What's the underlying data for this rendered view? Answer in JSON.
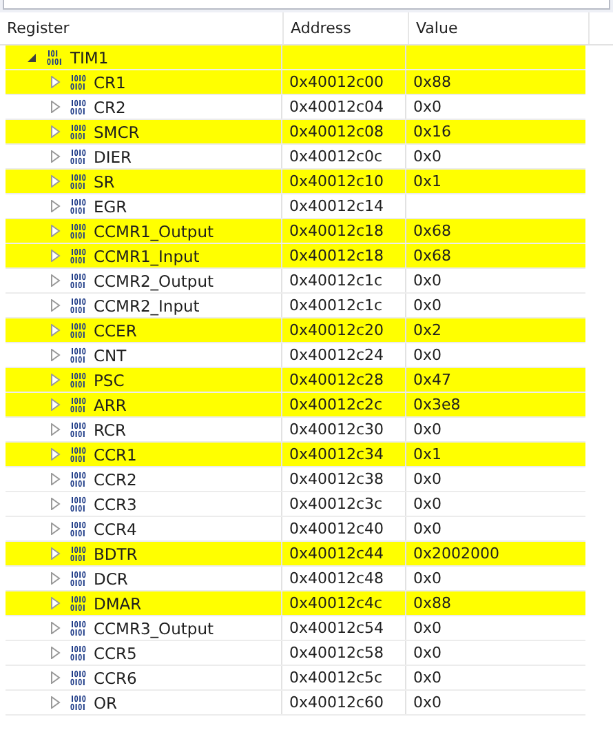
{
  "columns": [
    "Register",
    "Address",
    "Value"
  ],
  "tree": [
    {
      "name": "TIM1",
      "kind": "peripheral",
      "expanded": true,
      "highlighted": true,
      "children": [
        {
          "name": "CR1",
          "kind": "register",
          "expanded": false,
          "highlighted": true,
          "address": "0x40012c00",
          "value": "0x88"
        },
        {
          "name": "CR2",
          "kind": "register",
          "expanded": false,
          "highlighted": false,
          "address": "0x40012c04",
          "value": "0x0"
        },
        {
          "name": "SMCR",
          "kind": "register",
          "expanded": false,
          "highlighted": true,
          "address": "0x40012c08",
          "value": "0x16"
        },
        {
          "name": "DIER",
          "kind": "register",
          "expanded": false,
          "highlighted": false,
          "address": "0x40012c0c",
          "value": "0x0"
        },
        {
          "name": "SR",
          "kind": "register",
          "expanded": false,
          "highlighted": true,
          "address": "0x40012c10",
          "value": "0x1"
        },
        {
          "name": "EGR",
          "kind": "register",
          "expanded": false,
          "highlighted": false,
          "address": "0x40012c14"
        },
        {
          "name": "CCMR1_Output",
          "kind": "register",
          "expanded": false,
          "highlighted": true,
          "address": "0x40012c18",
          "value": "0x68"
        },
        {
          "name": "CCMR1_Input",
          "kind": "register",
          "expanded": false,
          "highlighted": true,
          "address": "0x40012c18",
          "value": "0x68"
        },
        {
          "name": "CCMR2_Output",
          "kind": "register",
          "expanded": false,
          "highlighted": false,
          "address": "0x40012c1c",
          "value": "0x0"
        },
        {
          "name": "CCMR2_Input",
          "kind": "register",
          "expanded": false,
          "highlighted": false,
          "address": "0x40012c1c",
          "value": "0x0"
        },
        {
          "name": "CCER",
          "kind": "register",
          "expanded": false,
          "highlighted": true,
          "address": "0x40012c20",
          "value": "0x2"
        },
        {
          "name": "CNT",
          "kind": "register",
          "expanded": false,
          "highlighted": false,
          "address": "0x40012c24",
          "value": "0x0"
        },
        {
          "name": "PSC",
          "kind": "register",
          "expanded": false,
          "highlighted": true,
          "address": "0x40012c28",
          "value": "0x47"
        },
        {
          "name": "ARR",
          "kind": "register",
          "expanded": false,
          "highlighted": true,
          "address": "0x40012c2c",
          "value": "0x3e8"
        },
        {
          "name": "RCR",
          "kind": "register",
          "expanded": false,
          "highlighted": false,
          "address": "0x40012c30",
          "value": "0x0"
        },
        {
          "name": "CCR1",
          "kind": "register",
          "expanded": false,
          "highlighted": true,
          "address": "0x40012c34",
          "value": "0x1"
        },
        {
          "name": "CCR2",
          "kind": "register",
          "expanded": false,
          "highlighted": false,
          "address": "0x40012c38",
          "value": "0x0"
        },
        {
          "name": "CCR3",
          "kind": "register",
          "expanded": false,
          "highlighted": false,
          "address": "0x40012c3c",
          "value": "0x0"
        },
        {
          "name": "CCR4",
          "kind": "register",
          "expanded": false,
          "highlighted": false,
          "address": "0x40012c40",
          "value": "0x0"
        },
        {
          "name": "BDTR",
          "kind": "register",
          "expanded": false,
          "highlighted": true,
          "address": "0x40012c44",
          "value": "0x2002000"
        },
        {
          "name": "DCR",
          "kind": "register",
          "expanded": false,
          "highlighted": false,
          "address": "0x40012c48",
          "value": "0x0"
        },
        {
          "name": "DMAR",
          "kind": "register",
          "expanded": false,
          "highlighted": true,
          "address": "0x40012c4c",
          "value": "0x88"
        },
        {
          "name": "CCMR3_Output",
          "kind": "register",
          "expanded": false,
          "highlighted": false,
          "address": "0x40012c54",
          "value": "0x0"
        },
        {
          "name": "CCR5",
          "kind": "register",
          "expanded": false,
          "highlighted": false,
          "address": "0x40012c58",
          "value": "0x0"
        },
        {
          "name": "CCR6",
          "kind": "register",
          "expanded": false,
          "highlighted": false,
          "address": "0x40012c5c",
          "value": "0x0"
        },
        {
          "name": "OR",
          "kind": "register",
          "expanded": false,
          "highlighted": false,
          "address": "0x40012c60",
          "value": "0x0"
        }
      ]
    }
  ]
}
